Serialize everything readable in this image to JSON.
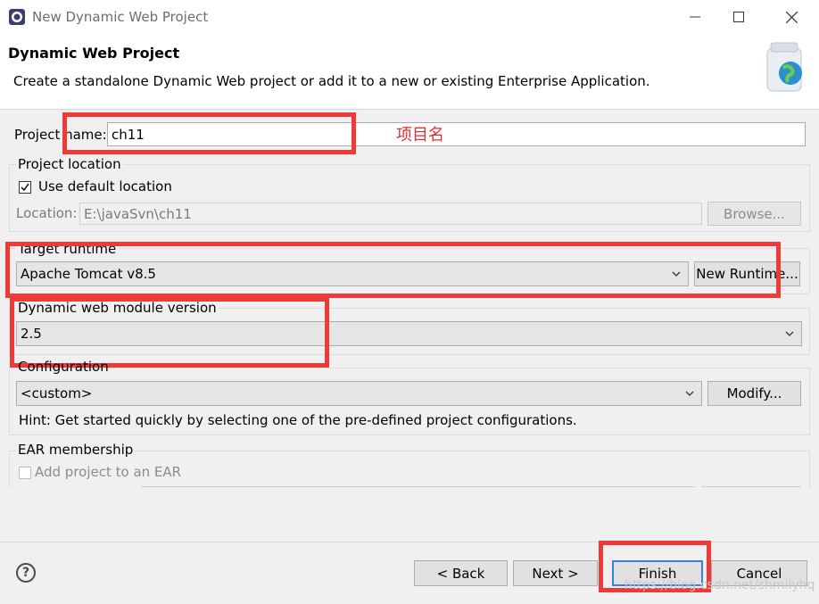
{
  "window": {
    "title": "New Dynamic Web Project",
    "minimize_icon": "minimize-icon",
    "maximize_icon": "maximize-icon",
    "close_icon": "close-icon"
  },
  "header": {
    "title": "Dynamic Web Project",
    "description": "Create a standalone Dynamic Web project or add it to a new or existing Enterprise Application."
  },
  "project_name": {
    "label": "Project name:",
    "value": "ch11"
  },
  "annotation": "项目名",
  "project_location": {
    "group_title": "Project location",
    "use_default_label": "Use default location",
    "use_default_checked": true,
    "location_label": "Location:",
    "location_value": "E:\\javaSvn\\ch11",
    "browse_label": "Browse..."
  },
  "target_runtime": {
    "group_title": "Target runtime",
    "selected": "Apache Tomcat v8.5",
    "new_runtime_label": "New Runtime..."
  },
  "module_version": {
    "group_title": "Dynamic web module version",
    "selected": "2.5"
  },
  "configuration": {
    "group_title": "Configuration",
    "selected": "<custom>",
    "modify_label": "Modify...",
    "hint": "Hint: Get started quickly by selecting one of the pre-defined project configurations."
  },
  "ear": {
    "group_title": "EAR membership",
    "add_label": "Add project to an EAR",
    "add_checked": false
  },
  "footer": {
    "help_icon": "help-icon",
    "help_glyph": "?",
    "back_label": "< Back",
    "next_label": "Next >",
    "finish_label": "Finish",
    "cancel_label": "Cancel",
    "watermark": "https://blog.csdn.net/shmilyhq"
  },
  "colors": {
    "highlight_red": "#ef3a3a",
    "annotation_red": "#e03030"
  }
}
